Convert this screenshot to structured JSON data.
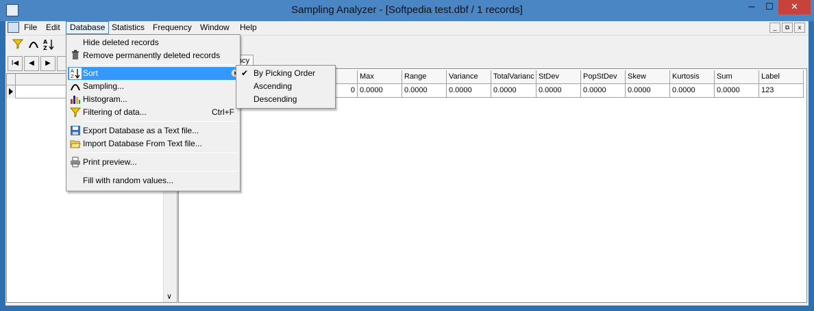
{
  "window": {
    "title": "Sampling Analyzer - [Softpedia test.dbf / 1 records]",
    "min": "─",
    "max": "☐",
    "close": "✕"
  },
  "menubar": {
    "items": [
      "File",
      "Edit",
      "Database",
      "Statistics",
      "Frequency",
      "Window",
      "Help"
    ],
    "active": "Database"
  },
  "mdi_buttons": {
    "min": "_",
    "restore": "⧉",
    "close": "x"
  },
  "toolbar": {
    "icons": [
      "filter-icon",
      "histogram-icon",
      "sort-az-icon"
    ]
  },
  "nav": {
    "first": "I◀",
    "prev": "◀",
    "next": "▶"
  },
  "tabs": [
    {
      "label": "ncy"
    }
  ],
  "grid": {
    "headers": [
      "Max",
      "Range",
      "Variance",
      "TotalVarianc",
      "StDev",
      "PopStDev",
      "Skew",
      "Kurtosis",
      "Sum",
      "Label"
    ],
    "row": [
      "0.0000",
      "0.0000",
      "0.0000",
      "0.0000",
      "0.0000",
      "0.0000",
      "0.0000",
      "0.0000",
      "0.0000",
      "123"
    ],
    "partial_cell": "0"
  },
  "database_menu": {
    "items": [
      {
        "label": "Hide deleted records",
        "icon": "",
        "shortcut": ""
      },
      {
        "label": "Remove permanently deleted records",
        "icon": "trash-icon",
        "shortcut": ""
      },
      {
        "label": "Sort",
        "icon": "sort-az-icon",
        "shortcut": "",
        "submenu": true,
        "highlighted": true
      },
      {
        "label": "Sampling...",
        "icon": "sampling-icon",
        "shortcut": ""
      },
      {
        "label": "Histogram...",
        "icon": "histogram-icon",
        "shortcut": ""
      },
      {
        "label": "Filtering of data...",
        "icon": "filter-icon",
        "shortcut": "Ctrl+F"
      },
      {
        "label": "Export Database as a Text file...",
        "icon": "save-icon",
        "shortcut": ""
      },
      {
        "label": "Import Database From Text file...",
        "icon": "folder-icon",
        "shortcut": ""
      },
      {
        "label": "Print preview...",
        "icon": "printer-icon",
        "shortcut": ""
      },
      {
        "label": "Fill with random values...",
        "icon": "",
        "shortcut": ""
      }
    ]
  },
  "sort_submenu": {
    "items": [
      {
        "label": "By Picking Order",
        "checked": true
      },
      {
        "label": "Ascending",
        "checked": false
      },
      {
        "label": "Descending",
        "checked": false
      }
    ]
  }
}
